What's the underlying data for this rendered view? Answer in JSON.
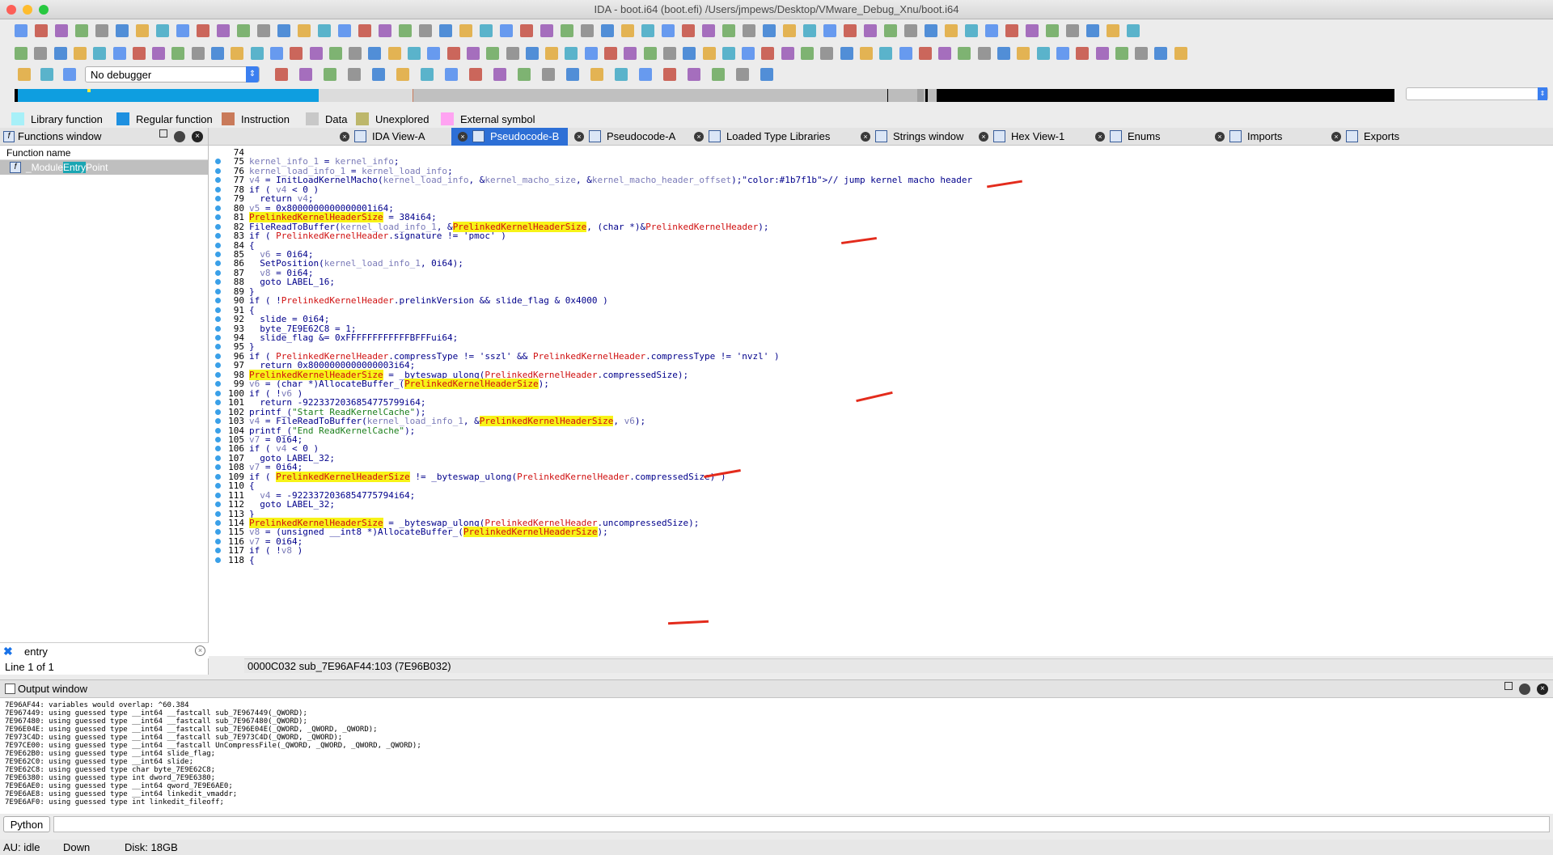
{
  "window": {
    "title": "IDA - boot.i64 (boot.efi) /Users/jmpews/Desktop/VMware_Debug_Xnu/boot.i64"
  },
  "debugger": {
    "selected": "No debugger"
  },
  "legend": [
    {
      "label": "Library function",
      "color": "#a7f0f8"
    },
    {
      "label": "Regular function",
      "color": "#1e90e0"
    },
    {
      "label": "Instruction",
      "color": "#c97a5a"
    },
    {
      "label": "Data",
      "color": "#c8c8c8"
    },
    {
      "label": "Unexplored",
      "color": "#bdb76b"
    },
    {
      "label": "External symbol",
      "color": "#ffa3f2"
    }
  ],
  "functions": {
    "title": "Functions window",
    "column": "Function name",
    "items": [
      {
        "prefix": "_Module",
        "match": "Entry",
        "suffix": "Point"
      }
    ],
    "filter": "entry",
    "count": "Line 1 of 1"
  },
  "tabs": [
    "IDA View-A",
    "Pseudocode-B",
    "Pseudocode-A",
    "Loaded Type Libraries",
    "Strings window",
    "Hex View-1",
    "Enums",
    "Imports",
    "Exports"
  ],
  "code": {
    "lines": [
      {
        "n": "74",
        "t": ""
      },
      {
        "n": "75",
        "t": "kernel_info_1 = kernel_info;"
      },
      {
        "n": "76",
        "t": "kernel_load_info_1 = kernel_load_info;"
      },
      {
        "n": "77",
        "t": "v4 = InitLoadKernelMacho(kernel_load_info, &kernel_macho_size, &kernel_macho_header_offset);// jump kernel macho header"
      },
      {
        "n": "78",
        "t": "if ( v4 < 0 )"
      },
      {
        "n": "79",
        "t": "  return v4;"
      },
      {
        "n": "80",
        "t": "v5 = 0x8000000000000001i64;"
      },
      {
        "n": "81",
        "t": "PrelinkedKernelHeaderSize = 384i64;"
      },
      {
        "n": "82",
        "t": "FileReadToBuffer(kernel_load_info_1, &PrelinkedKernelHeaderSize, (char *)&PrelinkedKernelHeader);"
      },
      {
        "n": "83",
        "t": "if ( PrelinkedKernelHeader.signature != 'pmoc' )"
      },
      {
        "n": "84",
        "t": "{"
      },
      {
        "n": "85",
        "t": "  v6 = 0i64;"
      },
      {
        "n": "86",
        "t": "  SetPosition(kernel_load_info_1, 0i64);"
      },
      {
        "n": "87",
        "t": "  v8 = 0i64;"
      },
      {
        "n": "88",
        "t": "  goto LABEL_16;"
      },
      {
        "n": "89",
        "t": "}"
      },
      {
        "n": "90",
        "t": "if ( !PrelinkedKernelHeader.prelinkVersion && slide_flag & 0x4000 )"
      },
      {
        "n": "91",
        "t": "{"
      },
      {
        "n": "92",
        "t": "  slide = 0i64;"
      },
      {
        "n": "93",
        "t": "  byte_7E9E62C8 = 1;"
      },
      {
        "n": "94",
        "t": "  slide_flag &= 0xFFFFFFFFFFFFBFFFui64;"
      },
      {
        "n": "95",
        "t": "}"
      },
      {
        "n": "96",
        "t": "if ( PrelinkedKernelHeader.compressType != 'sszl' && PrelinkedKernelHeader.compressType != 'nvzl' )"
      },
      {
        "n": "97",
        "t": "  return 0x8000000000000003i64;"
      },
      {
        "n": "98",
        "t": "PrelinkedKernelHeaderSize = _byteswap_ulong(PrelinkedKernelHeader.compressedSize);"
      },
      {
        "n": "99",
        "t": "v6 = (char *)AllocateBuffer_(PrelinkedKernelHeaderSize);"
      },
      {
        "n": "100",
        "t": "if ( !v6 )"
      },
      {
        "n": "101",
        "t": "  return -9223372036854775799i64;"
      },
      {
        "n": "102",
        "t": "printf_(\"Start ReadKernelCache\");"
      },
      {
        "n": "103",
        "t": "v4 = FileReadToBuffer(kernel_load_info_1, &PrelinkedKernelHeaderSize, v6);"
      },
      {
        "n": "104",
        "t": "printf_(\"End ReadKernelCache\");"
      },
      {
        "n": "105",
        "t": "v7 = 0i64;"
      },
      {
        "n": "106",
        "t": "if ( v4 < 0 )"
      },
      {
        "n": "107",
        "t": "  goto LABEL_32;"
      },
      {
        "n": "108",
        "t": "v7 = 0i64;"
      },
      {
        "n": "109",
        "t": "if ( PrelinkedKernelHeaderSize != _byteswap_ulong(PrelinkedKernelHeader.compressedSize) )"
      },
      {
        "n": "110",
        "t": "{"
      },
      {
        "n": "111",
        "t": "  v4 = -9223372036854775794i64;"
      },
      {
        "n": "112",
        "t": "  goto LABEL_32;"
      },
      {
        "n": "113",
        "t": "}"
      },
      {
        "n": "114",
        "t": "PrelinkedKernelHeaderSize = _byteswap_ulong(PrelinkedKernelHeader.uncompressedSize);"
      },
      {
        "n": "115",
        "t": "v8 = (unsigned __int8 *)AllocateBuffer_(PrelinkedKernelHeaderSize);"
      },
      {
        "n": "116",
        "t": "v7 = 0i64;"
      },
      {
        "n": "117",
        "t": "if ( !v8 )"
      },
      {
        "n": "118",
        "t": "{"
      }
    ],
    "status": "0000C032  sub_7E96AF44:103 (7E96B032)"
  },
  "output": {
    "title": "Output window",
    "lines": [
      "7E96AF44: variables would overlap: ^60.384",
      "7E967449: using guessed type __int64 __fastcall sub_7E967449(_QWORD);",
      "7E967480: using guessed type __int64 __fastcall sub_7E967480(_QWORD);",
      "7E96E04E: using guessed type __int64 __fastcall sub_7E96E04E(_QWORD, _QWORD, _QWORD);",
      "7E973C4D: using guessed type __int64 __fastcall sub_7E973C4D(_QWORD, _QWORD);",
      "7E97CE00: using guessed type __int64 __fastcall UnCompressFile(_QWORD, _QWORD, _QWORD, _QWORD);",
      "7E9E62B0: using guessed type __int64 slide_flag;",
      "7E9E62C0: using guessed type __int64 slide;",
      "7E9E62C8: using guessed type char byte_7E9E62C8;",
      "7E9E6380: using guessed type int dword_7E9E6380;",
      "7E9E6AE0: using guessed type __int64 qword_7E9E6AE0;",
      "7E9E6AE8: using guessed type __int64 linkedit_vmaddr;",
      "7E9E6AF0: using guessed type int linkedit_fileoff;"
    ]
  },
  "python": {
    "label": "Python"
  },
  "statusbar": {
    "au": "AU:  idle",
    "dir": "Down",
    "disk": "Disk: 18GB"
  }
}
